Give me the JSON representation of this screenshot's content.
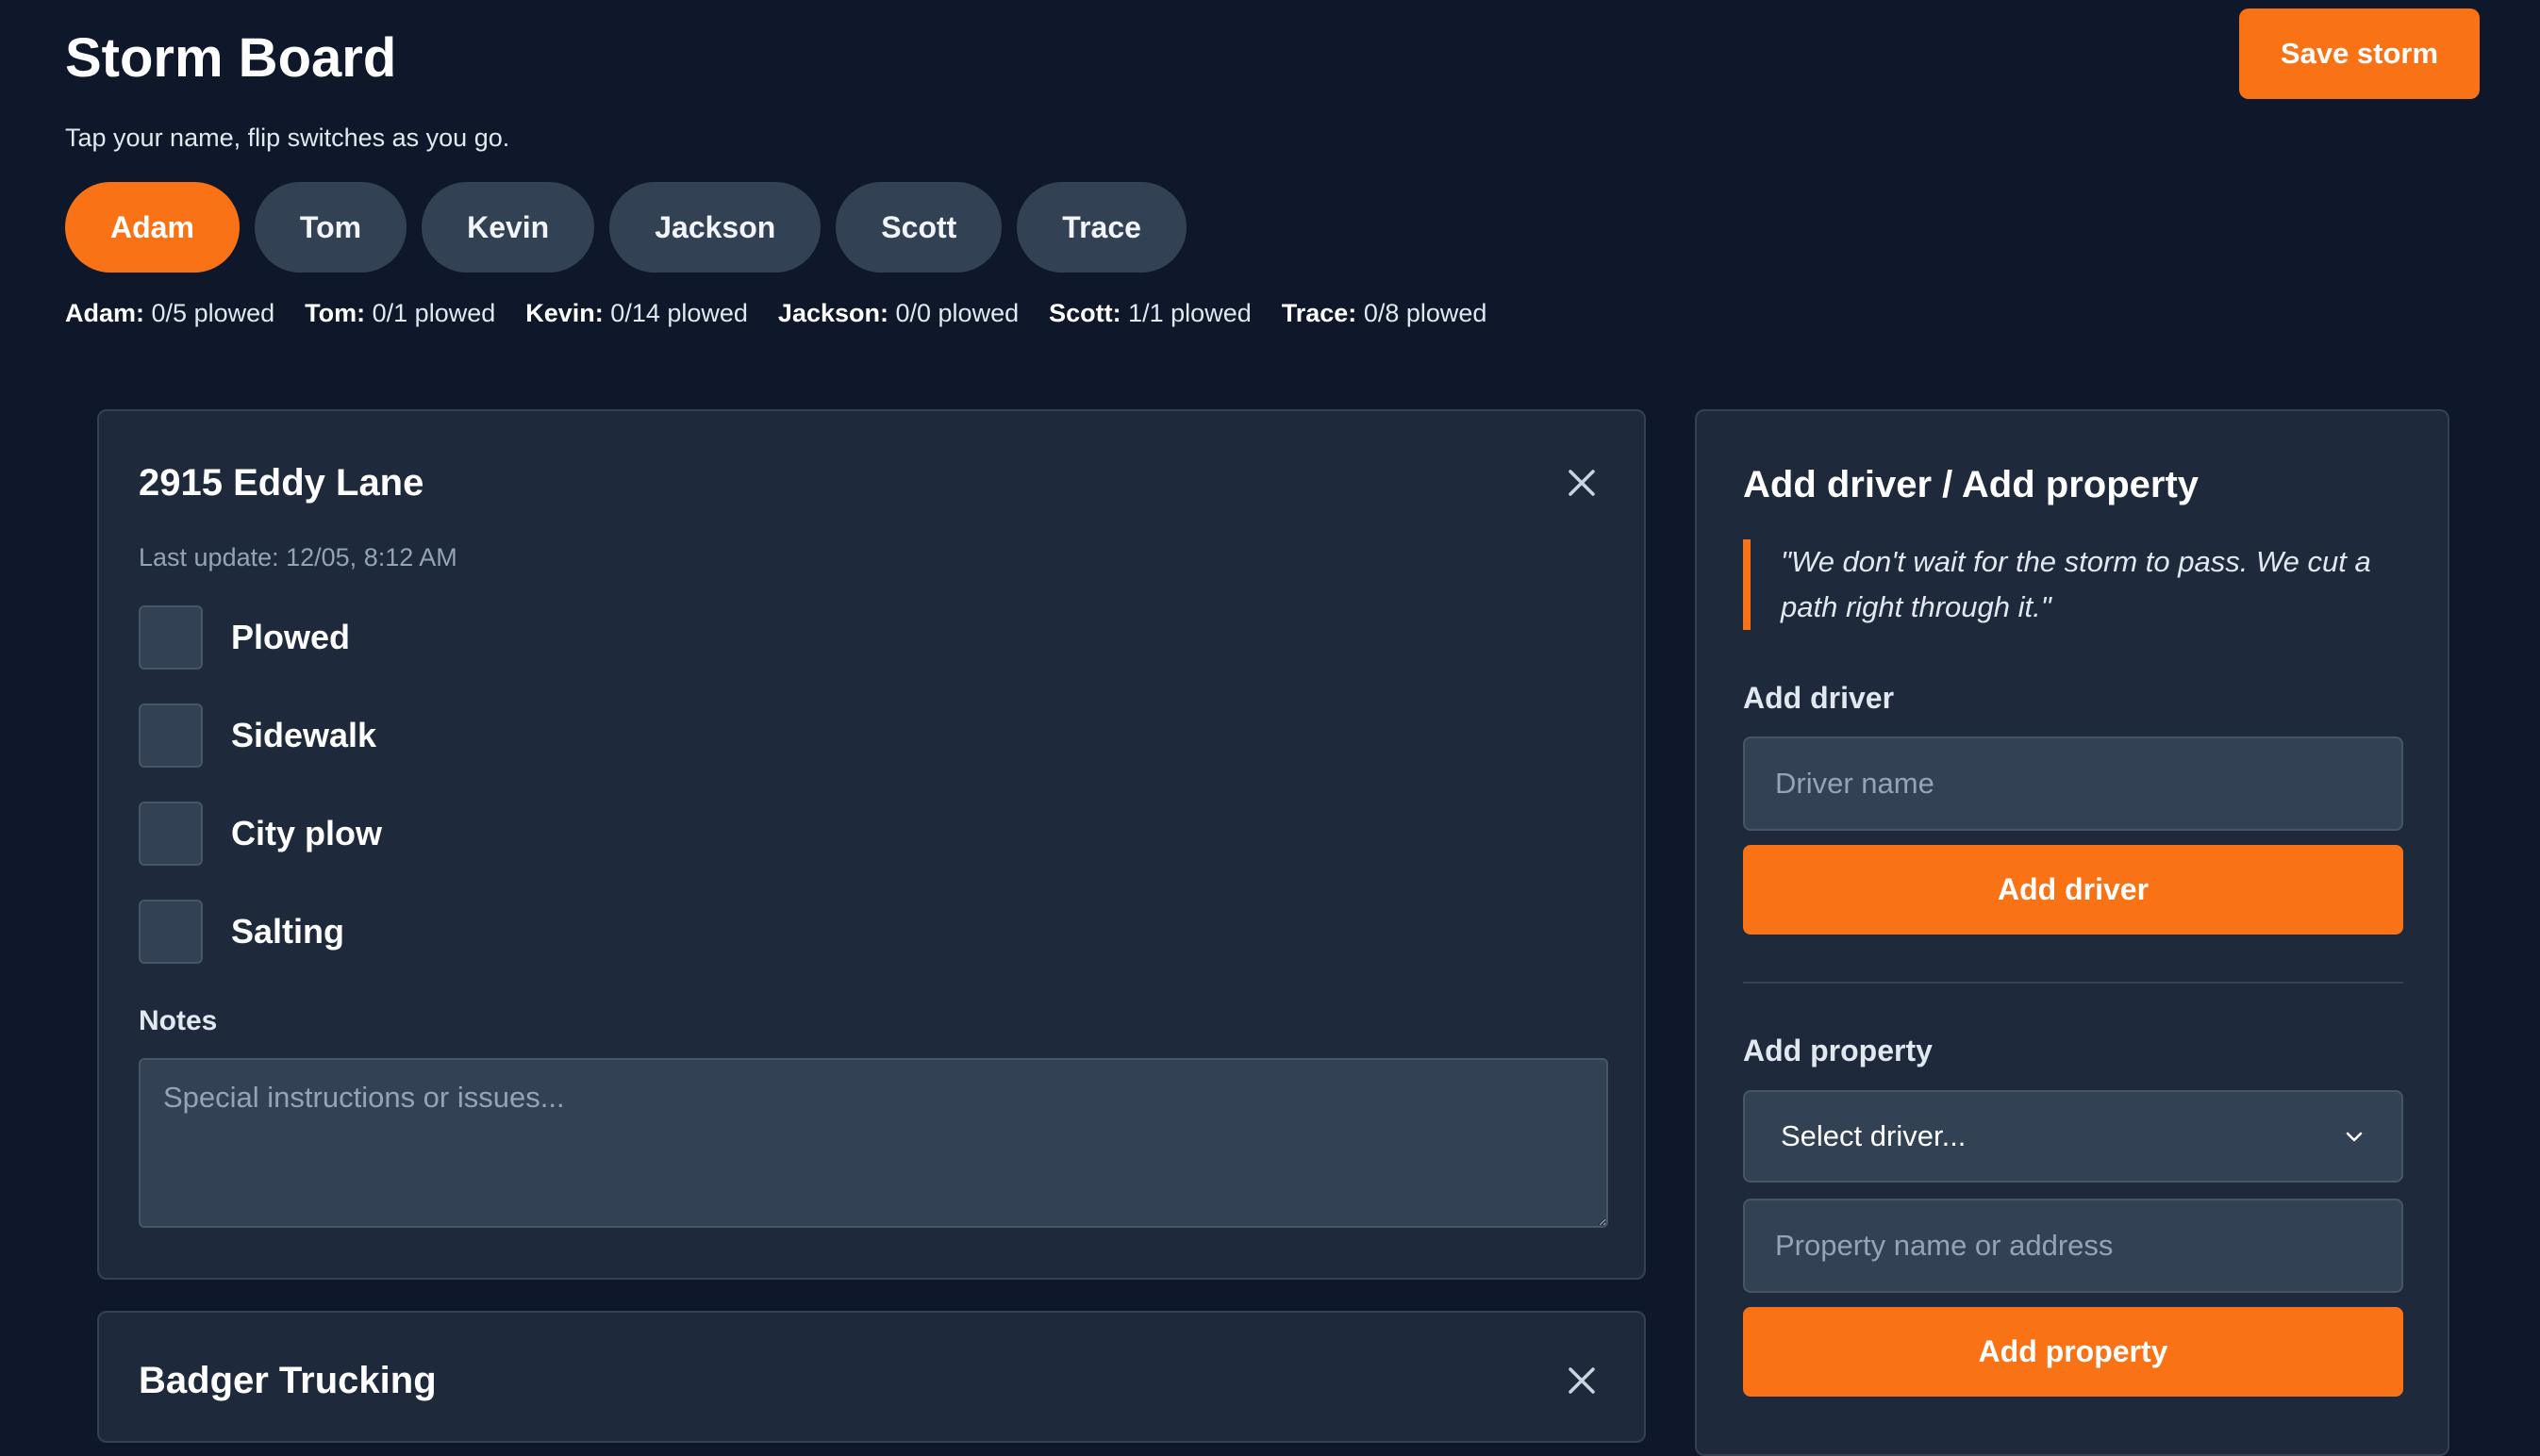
{
  "header": {
    "title": "Storm Board",
    "save_label": "Save storm",
    "subtitle": "Tap your name, flip switches as you go."
  },
  "drivers": [
    {
      "name": "Adam",
      "active": true
    },
    {
      "name": "Tom",
      "active": false
    },
    {
      "name": "Kevin",
      "active": false
    },
    {
      "name": "Jackson",
      "active": false
    },
    {
      "name": "Scott",
      "active": false
    },
    {
      "name": "Trace",
      "active": false
    }
  ],
  "stats": [
    {
      "name": "Adam:",
      "value": "0/5 plowed"
    },
    {
      "name": "Tom:",
      "value": "0/1 plowed"
    },
    {
      "name": "Kevin:",
      "value": "0/14 plowed"
    },
    {
      "name": "Jackson:",
      "value": "0/0 plowed"
    },
    {
      "name": "Scott:",
      "value": "1/1 plowed"
    },
    {
      "name": "Trace:",
      "value": "0/8 plowed"
    }
  ],
  "properties": [
    {
      "title": "2915 Eddy Lane",
      "last_update": "Last update: 12/05, 8:12 AM",
      "checks": [
        "Plowed",
        "Sidewalk",
        "City plow",
        "Salting"
      ],
      "notes_label": "Notes",
      "notes_placeholder": "Special instructions or issues..."
    },
    {
      "title": "Badger Trucking"
    }
  ],
  "side": {
    "title": "Add driver / Add property",
    "quote": "\"We don't wait for the storm to pass. We cut a path right through it.\"",
    "add_driver_label": "Add driver",
    "driver_name_placeholder": "Driver name",
    "add_driver_button": "Add driver",
    "add_property_label": "Add property",
    "select_driver": "Select driver...",
    "property_placeholder": "Property name or address",
    "add_property_button": "Add property"
  },
  "colors": {
    "accent": "#f97316",
    "background": "#0f172a",
    "card": "#1e293b",
    "input": "#334155"
  }
}
